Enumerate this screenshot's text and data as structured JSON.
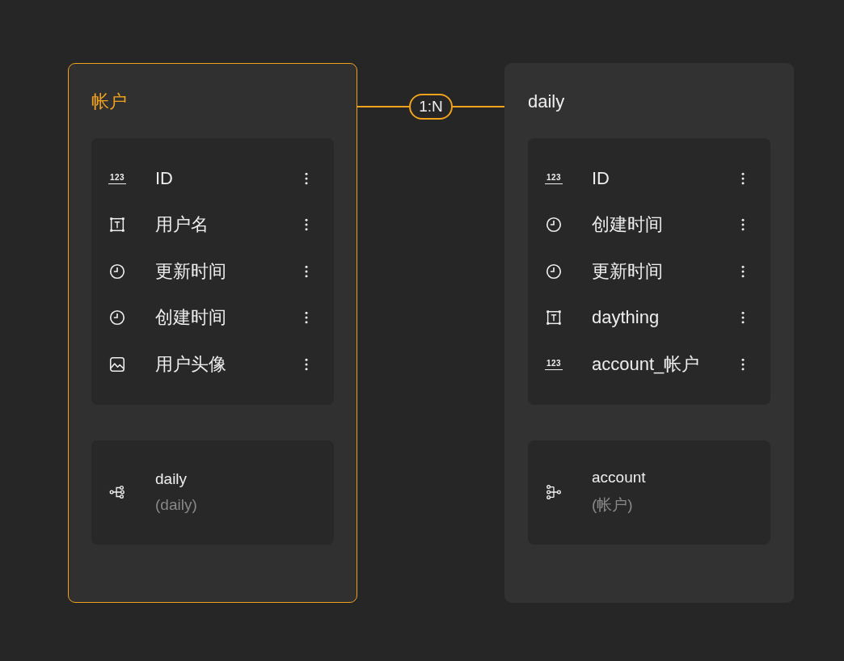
{
  "tables": [
    {
      "title": "帐户",
      "selected": true,
      "fields": [
        {
          "kind": "number",
          "type_label": "123",
          "name": "ID"
        },
        {
          "kind": "text",
          "name": "用户名"
        },
        {
          "kind": "datetime",
          "name": "更新时间"
        },
        {
          "kind": "datetime",
          "name": "创建时间"
        },
        {
          "kind": "image",
          "name": "用户头像"
        }
      ],
      "relations": [
        {
          "kind": "has-many",
          "name": "daily",
          "target": "(daily)"
        }
      ]
    },
    {
      "title": "daily",
      "selected": false,
      "fields": [
        {
          "kind": "number",
          "type_label": "123",
          "name": "ID"
        },
        {
          "kind": "datetime",
          "name": "创建时间"
        },
        {
          "kind": "datetime",
          "name": "更新时间"
        },
        {
          "kind": "text",
          "name": "daything"
        },
        {
          "kind": "number",
          "type_label": "123",
          "name": "account_帐户"
        }
      ],
      "relations": [
        {
          "kind": "belongs-to",
          "name": "account",
          "target": "(帐户)"
        }
      ]
    }
  ],
  "link": {
    "label": "1:N"
  }
}
